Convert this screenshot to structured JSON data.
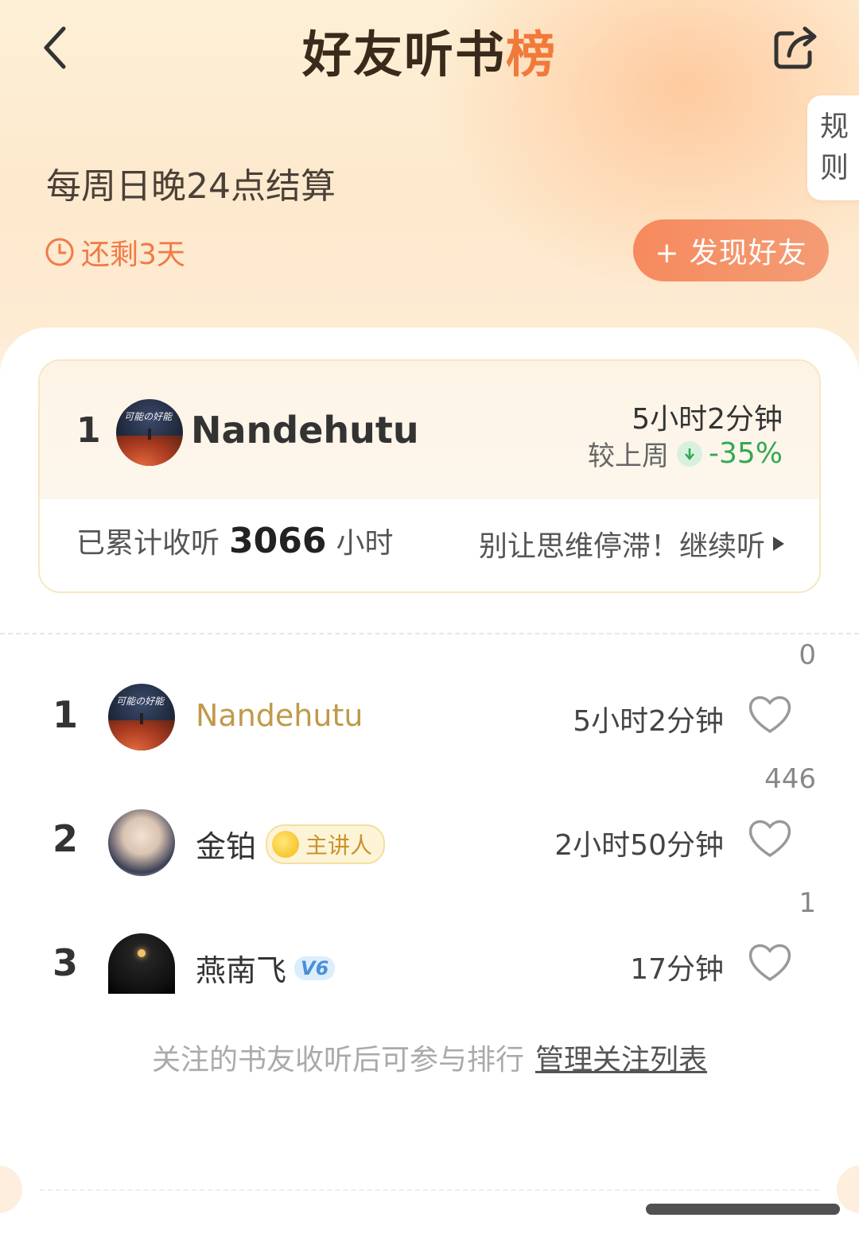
{
  "header": {
    "title_main": "好友听书",
    "title_accent": "榜"
  },
  "rules_label": "规\n则",
  "settlement": "每周日晚24点结算",
  "remaining": "还剩3天",
  "discover_button": "+ 发现好友",
  "my_card": {
    "rank": "1",
    "name": "Nandehutu",
    "avatar_text": "可能の好能",
    "time": "5小时2分钟",
    "compare_label": "较上周",
    "change": "-35%",
    "cumulative_prefix": "已累计收听",
    "cumulative_hours": "3066",
    "cumulative_unit": "小时",
    "cta": "别让思维停滞！继续听"
  },
  "rows": [
    {
      "rank": "1",
      "name": "Nandehutu",
      "avatar_text": "可能の好能",
      "duration": "5小时2分钟",
      "likes": "0"
    },
    {
      "rank": "2",
      "name": "金铂",
      "badge": "主讲人",
      "duration": "2小时50分钟",
      "likes": "446"
    },
    {
      "rank": "3",
      "name": "燕南飞",
      "vbadge": "V6",
      "duration": "17分钟",
      "likes": "1"
    }
  ],
  "footer": {
    "note": "关注的书友收听后可参与排行",
    "link": "管理关注列表"
  },
  "colors": {
    "accent": "#f07a45",
    "button": "#f68a5e",
    "down": "#33a853",
    "gold_name": "#c09a4a"
  },
  "icons": [
    "back-arrow-icon",
    "share-icon",
    "clock-icon",
    "down-arrow-icon",
    "play-triangle-icon",
    "heart-icon"
  ]
}
